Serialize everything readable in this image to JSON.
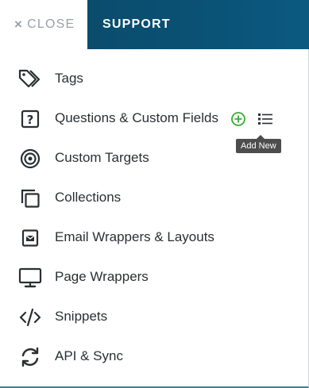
{
  "header": {
    "close_icon": "×",
    "close_label": "CLOSE",
    "tab_label": "SUPPORT"
  },
  "menu": {
    "items": [
      {
        "label": "Tags",
        "icon": "tag-icon"
      },
      {
        "label": "Questions & Custom Fields",
        "icon": "question-box-icon"
      },
      {
        "label": "Custom Targets",
        "icon": "target-icon"
      },
      {
        "label": "Collections",
        "icon": "collections-icon"
      },
      {
        "label": "Email Wrappers & Layouts",
        "icon": "email-icon"
      },
      {
        "label": "Page Wrappers",
        "icon": "monitor-icon"
      },
      {
        "label": "Snippets",
        "icon": "code-icon"
      },
      {
        "label": "API & Sync",
        "icon": "sync-icon"
      }
    ]
  },
  "actions": {
    "add_icon": "plus-circle-icon",
    "list_icon": "list-icon",
    "tooltip": "Add New"
  },
  "colors": {
    "accent": "#0b4c6c",
    "add_green": "#3aaa35",
    "icon": "#2b2f33",
    "muted": "#9aa1a6"
  }
}
